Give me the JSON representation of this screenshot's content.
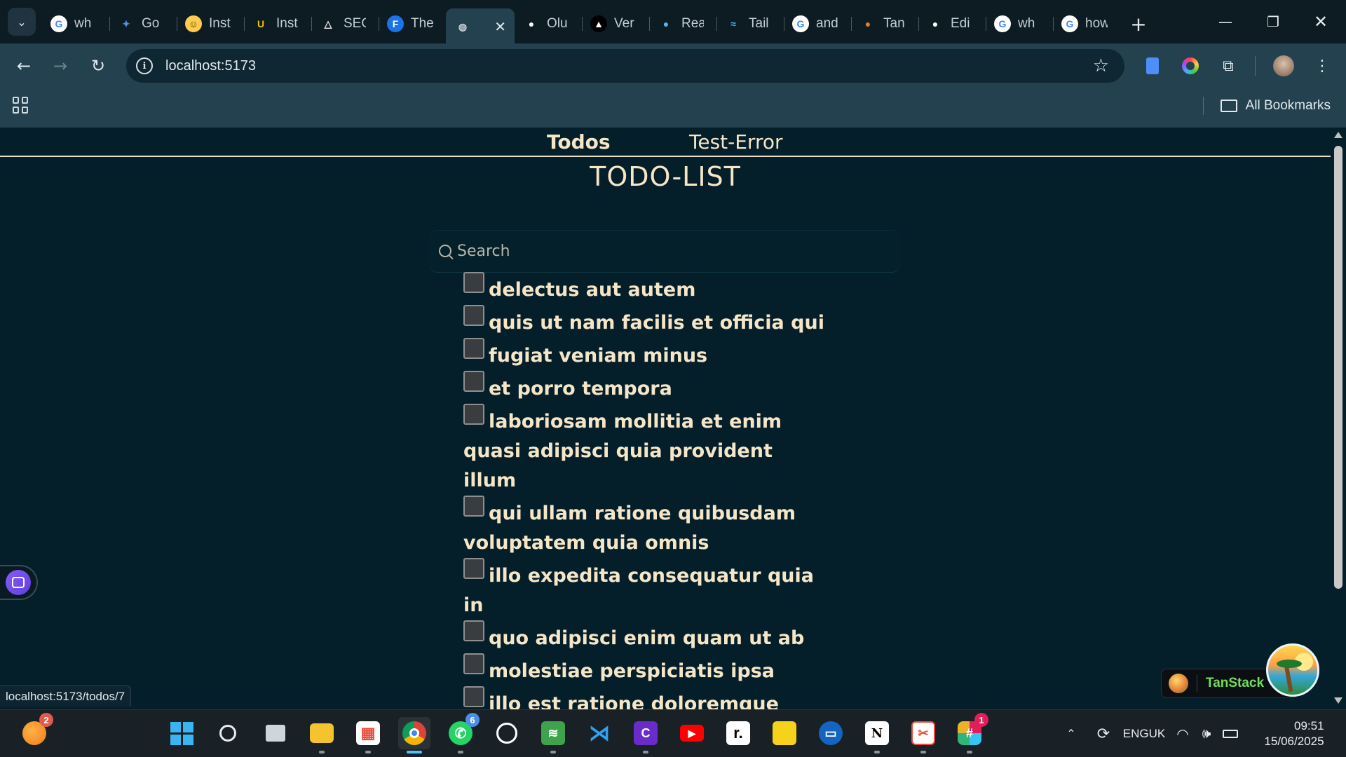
{
  "browser": {
    "tabs": [
      {
        "label": "wh",
        "fav": "G",
        "fav_color": "#4285f4",
        "fav_bg": "#ffffff"
      },
      {
        "label": "Go",
        "fav": "✦",
        "fav_color": "#5b8def",
        "fav_bg": "transparent"
      },
      {
        "label": "Inst",
        "fav": "☺",
        "fav_color": "#5a3b00",
        "fav_bg": "#ffcc4d"
      },
      {
        "label": "Inst",
        "fav": "U",
        "fav_color": "#f5c400",
        "fav_bg": "transparent"
      },
      {
        "label": "SEO",
        "fav": "△",
        "fav_color": "#e6e6e6",
        "fav_bg": "transparent"
      },
      {
        "label": "The",
        "fav": "F",
        "fav_color": "#ffffff",
        "fav_bg": "#1a73e8"
      },
      {
        "label": "",
        "fav": "◍",
        "fav_color": "#c8d2d8",
        "fav_bg": "transparent",
        "active": true,
        "close": "✕"
      },
      {
        "label": "Olu",
        "fav": "●",
        "fav_color": "#ffffff",
        "fav_bg": "transparent"
      },
      {
        "label": "Ver",
        "fav": "▲",
        "fav_color": "#ffffff",
        "fav_bg": "#000000"
      },
      {
        "label": "Rea",
        "fav": "●",
        "fav_color": "#5ab4f0",
        "fav_bg": "transparent"
      },
      {
        "label": "Tail",
        "fav": "≈",
        "fav_color": "#38bdf8",
        "fav_bg": "transparent"
      },
      {
        "label": "and",
        "fav": "G",
        "fav_color": "#4285f4",
        "fav_bg": "#ffffff"
      },
      {
        "label": "Tan",
        "fav": "●",
        "fav_color": "#e07b39",
        "fav_bg": "transparent"
      },
      {
        "label": "Edi",
        "fav": "●",
        "fav_color": "#ffffff",
        "fav_bg": "transparent"
      },
      {
        "label": "wh",
        "fav": "G",
        "fav_color": "#4285f4",
        "fav_bg": "#ffffff"
      },
      {
        "label": "how",
        "fav": "G",
        "fav_color": "#4285f4",
        "fav_bg": "#ffffff"
      }
    ],
    "new_tab": "+",
    "url": "localhost:5173",
    "all_bookmarks": "All Bookmarks",
    "status_url": "localhost:5173/todos/7"
  },
  "app": {
    "nav": {
      "todos": "Todos",
      "test_error": "Test-Error"
    },
    "title": "TODO-LIST",
    "search_placeholder": "Search",
    "todos": [
      {
        "text": "delectus aut autem",
        "checked": false
      },
      {
        "text": "quis ut nam facilis et officia qui",
        "checked": false
      },
      {
        "text": "fugiat veniam minus",
        "checked": false
      },
      {
        "text": "et porro tempora",
        "checked": false
      },
      {
        "text": "laboriosam mollitia et enim quasi adipisci quia provident illum",
        "checked": false
      },
      {
        "text": "qui ullam ratione quibusdam voluptatem quia omnis",
        "checked": false
      },
      {
        "text": "illo expedita consequatur quia in",
        "checked": false
      },
      {
        "text": "quo adipisci enim quam ut ab",
        "checked": false
      },
      {
        "text": "molestiae perspiciatis ipsa",
        "checked": false
      },
      {
        "text": "illo est ratione doloremque quia maiores aut",
        "checked": false
      }
    ],
    "devtools_label": "TanStack"
  },
  "taskbar": {
    "notification_count": "2",
    "whatsapp_badge": "6",
    "slack_badge": "1",
    "lang_line1": "ENG",
    "lang_line2": "UK",
    "time": "09:51",
    "date": "15/06/2025"
  },
  "colors": {
    "page_bg": "#041e2a",
    "text": "#f5e6c8",
    "chrome": "#23414f"
  }
}
